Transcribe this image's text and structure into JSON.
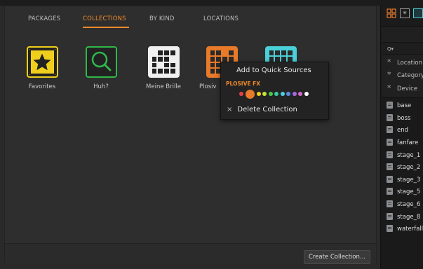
{
  "tabs": [
    {
      "label": "PACKAGES",
      "active": false
    },
    {
      "label": "COLLECTIONS",
      "active": true
    },
    {
      "label": "BY KIND",
      "active": false
    },
    {
      "label": "LOCATIONS",
      "active": false
    }
  ],
  "collections": [
    {
      "label": "Favorites",
      "icon": "star-icon",
      "color": "#f0cf1c"
    },
    {
      "label": "Huh?",
      "icon": "magnifier-icon",
      "color": "#2fb84a"
    },
    {
      "label": "Meine Brille",
      "icon": "grid-icon",
      "color": "#f0f0f0"
    },
    {
      "label": "Plosiv",
      "icon": "grid-icon",
      "color": "#e87a2a"
    },
    {
      "label": "",
      "icon": "grid-icon",
      "color": "#4ad0d8"
    }
  ],
  "context_menu": {
    "add_label": "Add to Quick Sources",
    "section_label": "PLOSIVE FX",
    "swatches": [
      "#e8404a",
      "#e87a2a",
      "#f0cf1c",
      "#c8e03a",
      "#4cc84a",
      "#3ac8a0",
      "#4ad0d8",
      "#5a8ae8",
      "#a868e8",
      "#d868c8",
      "#ffffff"
    ],
    "selected_swatch": 1,
    "delete_label": "Delete Collection",
    "delete_icon": "×"
  },
  "bottom": {
    "create_label": "Create Collection..."
  },
  "right_panel": {
    "search_icon": "Q▾",
    "filters": [
      "Location",
      "Category",
      "Device"
    ],
    "items": [
      "base",
      "boss",
      "end",
      "fanfare",
      "stage_1",
      "stage_2",
      "stage_3",
      "stage_5",
      "stage_6",
      "stage_8",
      "waterfall"
    ]
  }
}
